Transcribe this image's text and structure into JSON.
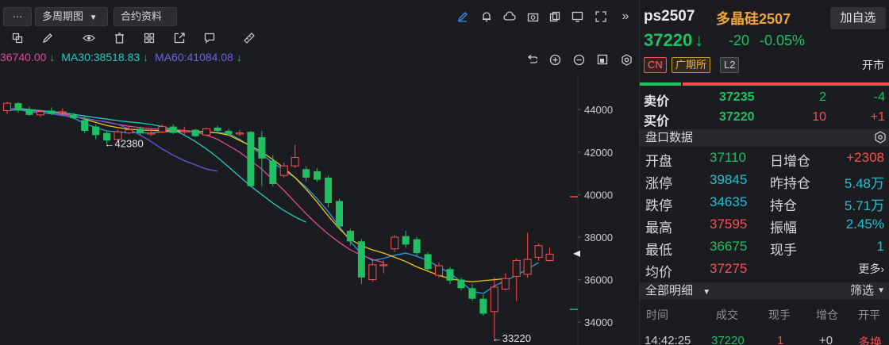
{
  "toolbar": {
    "menu_label": "···",
    "period_label": "多周期图",
    "contract_label": "合约资料"
  },
  "ma": {
    "ma_partial": "36740.00",
    "ma30": "MA30:38518.83",
    "ma60": "MA60:41084.08",
    "arrow": "↓"
  },
  "chart_data": {
    "type": "candlestick",
    "y_ticks": [
      "44000",
      "42000",
      "40000",
      "38000",
      "36000",
      "34000"
    ],
    "ylim": [
      33000,
      45200
    ],
    "annotations": [
      {
        "text": "←42380",
        "value": 42380
      },
      {
        "text": "←33220",
        "value": 33220
      }
    ],
    "candles": [
      {
        "o": 43950,
        "c": 44300,
        "h": 44350,
        "l": 43800
      },
      {
        "o": 44300,
        "c": 43950,
        "h": 44350,
        "l": 43850
      },
      {
        "o": 44000,
        "c": 43750,
        "h": 44150,
        "l": 43700
      },
      {
        "o": 43750,
        "c": 43900,
        "h": 44000,
        "l": 43650
      },
      {
        "o": 43950,
        "c": 43800,
        "h": 44100,
        "l": 43750
      },
      {
        "o": 43850,
        "c": 43900,
        "h": 44050,
        "l": 43700
      },
      {
        "o": 43750,
        "c": 43600,
        "h": 43850,
        "l": 43550
      },
      {
        "o": 43500,
        "c": 43000,
        "h": 43700,
        "l": 42900
      },
      {
        "o": 43200,
        "c": 42800,
        "h": 43300,
        "l": 42600
      },
      {
        "o": 42900,
        "c": 42550,
        "h": 43000,
        "l": 42380
      },
      {
        "o": 42600,
        "c": 42950,
        "h": 43050,
        "l": 42550
      },
      {
        "o": 42900,
        "c": 43050,
        "h": 43250,
        "l": 42850
      },
      {
        "o": 43100,
        "c": 42900,
        "h": 43200,
        "l": 42800
      },
      {
        "o": 42850,
        "c": 42900,
        "h": 43100,
        "l": 42750
      },
      {
        "o": 42950,
        "c": 43200,
        "h": 43300,
        "l": 42900
      },
      {
        "o": 43200,
        "c": 42900,
        "h": 43300,
        "l": 42850
      },
      {
        "o": 42950,
        "c": 43000,
        "h": 43200,
        "l": 42800
      },
      {
        "o": 43050,
        "c": 42750,
        "h": 43100,
        "l": 42700
      },
      {
        "o": 42800,
        "c": 43100,
        "h": 43150,
        "l": 42750
      },
      {
        "o": 43150,
        "c": 43000,
        "h": 43250,
        "l": 42900
      },
      {
        "o": 43000,
        "c": 42850,
        "h": 43100,
        "l": 42800
      },
      {
        "o": 42850,
        "c": 42900,
        "h": 43050,
        "l": 42750
      },
      {
        "o": 42950,
        "c": 40400,
        "h": 43000,
        "l": 40350
      },
      {
        "o": 42700,
        "c": 41700,
        "h": 43000,
        "l": 40400
      },
      {
        "o": 41600,
        "c": 40500,
        "h": 41850,
        "l": 40400
      },
      {
        "o": 40900,
        "c": 41350,
        "h": 41500,
        "l": 40800
      },
      {
        "o": 41350,
        "c": 41750,
        "h": 42350,
        "l": 41250
      },
      {
        "o": 41200,
        "c": 40800,
        "h": 41350,
        "l": 40600
      },
      {
        "o": 41100,
        "c": 40700,
        "h": 41250,
        "l": 40600
      },
      {
        "o": 40800,
        "c": 39600,
        "h": 40900,
        "l": 39400
      },
      {
        "o": 39700,
        "c": 38500,
        "h": 39800,
        "l": 38400
      },
      {
        "o": 38300,
        "c": 37800,
        "h": 38400,
        "l": 37600
      },
      {
        "o": 37800,
        "c": 36100,
        "h": 37900,
        "l": 35800
      },
      {
        "o": 36000,
        "c": 36700,
        "h": 36900,
        "l": 35900
      },
      {
        "o": 36700,
        "c": 36700,
        "h": 36900,
        "l": 36300
      },
      {
        "o": 37450,
        "c": 38000,
        "h": 38100,
        "l": 37300
      },
      {
        "o": 38050,
        "c": 37650,
        "h": 38300,
        "l": 37500
      },
      {
        "o": 37900,
        "c": 37250,
        "h": 38000,
        "l": 37100
      },
      {
        "o": 37200,
        "c": 36500,
        "h": 37300,
        "l": 36400
      },
      {
        "o": 36200,
        "c": 36650,
        "h": 36800,
        "l": 36100
      },
      {
        "o": 36500,
        "c": 35950,
        "h": 36600,
        "l": 35800
      },
      {
        "o": 36000,
        "c": 35600,
        "h": 36100,
        "l": 35500
      },
      {
        "o": 35600,
        "c": 35100,
        "h": 35800,
        "l": 35000
      },
      {
        "o": 35100,
        "c": 34400,
        "h": 35300,
        "l": 34300
      },
      {
        "o": 34500,
        "c": 35650,
        "h": 36100,
        "l": 33220
      },
      {
        "o": 35550,
        "c": 36050,
        "h": 36300,
        "l": 35500
      },
      {
        "o": 36150,
        "c": 36900,
        "h": 37000,
        "l": 35000
      },
      {
        "o": 36250,
        "c": 36950,
        "h": 38200,
        "l": 36100
      },
      {
        "o": 37050,
        "c": 37600,
        "h": 37700,
        "l": 36900
      },
      {
        "o": 36900,
        "c": 37200,
        "h": 37500,
        "l": 36850
      }
    ],
    "ma_lines": [
      {
        "color": "#2a9be0",
        "values": [
          43950,
          44000,
          43900,
          43850,
          43800,
          43750,
          43600,
          43350,
          43150,
          43000,
          42950,
          42920,
          42900,
          42900,
          42950,
          42960,
          42970,
          42960,
          42950,
          42920,
          42880,
          42600,
          42250,
          41900,
          41500,
          41150,
          40800,
          40350,
          39800,
          39200,
          38500,
          37800,
          37200,
          36900,
          37000,
          37150,
          37250,
          37100,
          36900,
          36600,
          36300,
          35900,
          35450,
          35350,
          35700,
          35950,
          36200,
          36500,
          36800
        ]
      },
      {
        "color": "#f0c419",
        "values": [
          44000,
          44050,
          44000,
          43950,
          43880,
          43800,
          43700,
          43550,
          43400,
          43250,
          43150,
          43080,
          43040,
          43020,
          43010,
          43000,
          42990,
          42970,
          42950,
          42900,
          42800,
          42550,
          42300,
          42000,
          41650,
          41250,
          40800,
          40250,
          39650,
          39000,
          38400,
          37900,
          37600,
          37400,
          37250,
          37050,
          36850,
          36600,
          36400,
          36200,
          36050,
          35950,
          35900,
          35950,
          36000,
          36050
        ]
      },
      {
        "color": "#e0489a",
        "values": [
          44000,
          44000,
          43950,
          43920,
          43880,
          43800,
          43700,
          43600,
          43500,
          43400,
          43300,
          43220,
          43150,
          43100,
          43070,
          43050,
          43020,
          42950,
          42800,
          42600,
          42300,
          42000,
          41600,
          41200,
          40700,
          40200,
          39650,
          39100,
          38600,
          38150,
          37750,
          37400,
          37150,
          36950,
          36800
        ]
      },
      {
        "color": "#20c9c0",
        "values": [
          44050,
          44020,
          44000,
          43950,
          43900,
          43850,
          43780,
          43700,
          43620,
          43550,
          43480,
          43420,
          43370,
          43300,
          43200,
          43050,
          42800,
          42500,
          42150,
          41750,
          41300,
          40850,
          40400,
          40000,
          39600,
          39250,
          38950,
          38700
        ]
      },
      {
        "color": "#5e5ad8",
        "values": [
          44050,
          44000,
          43950,
          43880,
          43800,
          43720,
          43650,
          43580,
          43500,
          43420,
          43300,
          43100,
          42800,
          42500,
          42150,
          41850,
          41600,
          41400,
          41200,
          41100
        ]
      }
    ]
  },
  "quote": {
    "symbol": "ps2507",
    "name": "多晶硅2507",
    "add_label": "加自选",
    "price": "37220",
    "arrow": "↓",
    "change": "-20",
    "change_pct": "-0.05%",
    "tag_cn": "CN",
    "tag_exchange": "广期所",
    "tag_l2": "L2",
    "open_label": "开市",
    "up_color": "#ff4d4f",
    "down_color": "#1fbf63"
  },
  "orderbook": {
    "ask": {
      "label": "卖价",
      "price": "37235",
      "vol": "2",
      "chg": "-4"
    },
    "bid": {
      "label": "买价",
      "price": "37220",
      "vol": "10",
      "chg": "+1"
    }
  },
  "panel": {
    "title": "盘口数据",
    "rows": [
      {
        "l1": "开盘",
        "v1": "37110",
        "l2": "日增仓",
        "v2": "+2308"
      },
      {
        "l1": "涨停",
        "v1": "39845",
        "l2": "昨持仓",
        "v2": "5.48万"
      },
      {
        "l1": "跌停",
        "v1": "34635",
        "l2": "持仓",
        "v2": "5.71万"
      },
      {
        "l1": "最高",
        "v1": "37595",
        "l2": "振幅",
        "v2": "2.45%"
      },
      {
        "l1": "最低",
        "v1": "36675",
        "l2": "现手",
        "v2": "1"
      },
      {
        "l1": "均价",
        "v1": "37275",
        "l2": "",
        "v2": "更多›"
      }
    ]
  },
  "trades": {
    "title": "全部明细",
    "filter": "筛选",
    "headers": [
      "时间",
      "成交",
      "现手",
      "增仓",
      "开平"
    ],
    "rows": [
      {
        "time": "14:42:25",
        "price": "37220",
        "vol": "1",
        "oi": "+0",
        "type": "多换"
      }
    ]
  }
}
